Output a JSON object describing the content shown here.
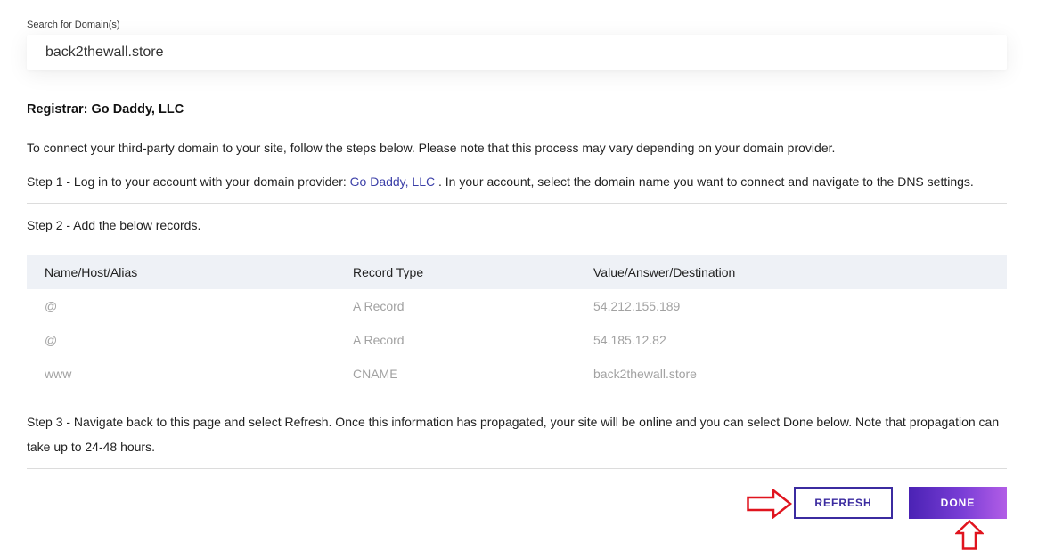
{
  "search": {
    "label": "Search for Domain(s)",
    "value": "back2thewall.store"
  },
  "registrar": {
    "label": "Registrar:",
    "value": "Go Daddy, LLC"
  },
  "intro": "To connect your third-party domain to your site, follow the steps below. Please note that this process may vary depending on your domain provider.",
  "step1": {
    "prefix": "Step 1 - Log in to your account with your domain provider:",
    "link": "Go Daddy, LLC",
    "suffix": ". In your account, select the domain name you want to connect and navigate to the DNS settings."
  },
  "step2": "Step 2 - Add the below records.",
  "table": {
    "headers": [
      "Name/Host/Alias",
      "Record Type",
      "Value/Answer/Destination"
    ],
    "rows": [
      [
        "@",
        "A Record",
        "54.212.155.189"
      ],
      [
        "@",
        "A Record",
        "54.185.12.82"
      ],
      [
        "www",
        "CNAME",
        "back2thewall.store"
      ]
    ]
  },
  "step3": "Step 3 - Navigate back to this page and select Refresh. Once this information has propagated, your site will be online and you can select Done below. Note that propagation can take up to 24-48 hours.",
  "buttons": {
    "refresh": "REFRESH",
    "done": "DONE"
  },
  "colors": {
    "accent": "#3b2ba0",
    "link": "#3b3fa8",
    "annotation_arrow": "#e0141e"
  },
  "annotations": {
    "arrow_right_icon": "red-outline-arrow-right",
    "arrow_up_icon": "red-outline-arrow-up"
  }
}
